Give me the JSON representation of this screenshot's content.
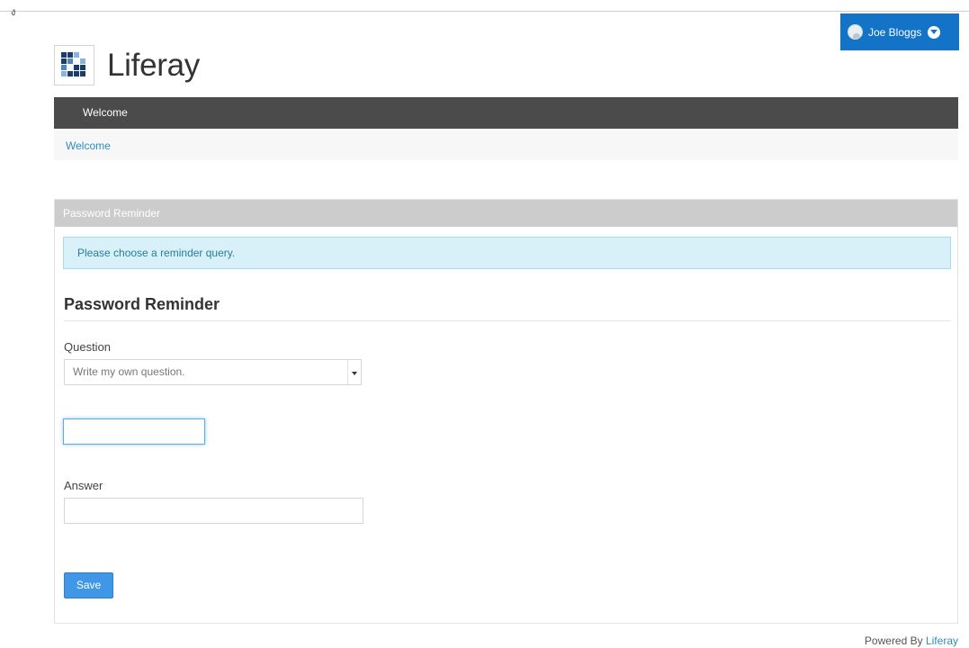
{
  "corner_mark": "ง",
  "user": {
    "name": "Joe Bloggs"
  },
  "site": {
    "name": "Liferay"
  },
  "nav": {
    "items": [
      {
        "label": "Welcome"
      }
    ]
  },
  "breadcrumb": {
    "items": [
      {
        "label": "Welcome"
      }
    ]
  },
  "portlet": {
    "title": "Password Reminder",
    "alert": "Please choose a reminder query.",
    "heading": "Password Reminder",
    "question_label": "Question",
    "question_selected": "Write my own question.",
    "custom_question_value": "",
    "answer_label": "Answer",
    "answer_value": "",
    "save_label": "Save"
  },
  "footer": {
    "powered_by": "Powered By",
    "link": "Liferay"
  },
  "colors": {
    "accent": "#1273c7",
    "navbar": "#4b4b4b",
    "button": "#3f97e6",
    "link": "#2d8ebf",
    "alert_bg": "#d8f1f9"
  }
}
